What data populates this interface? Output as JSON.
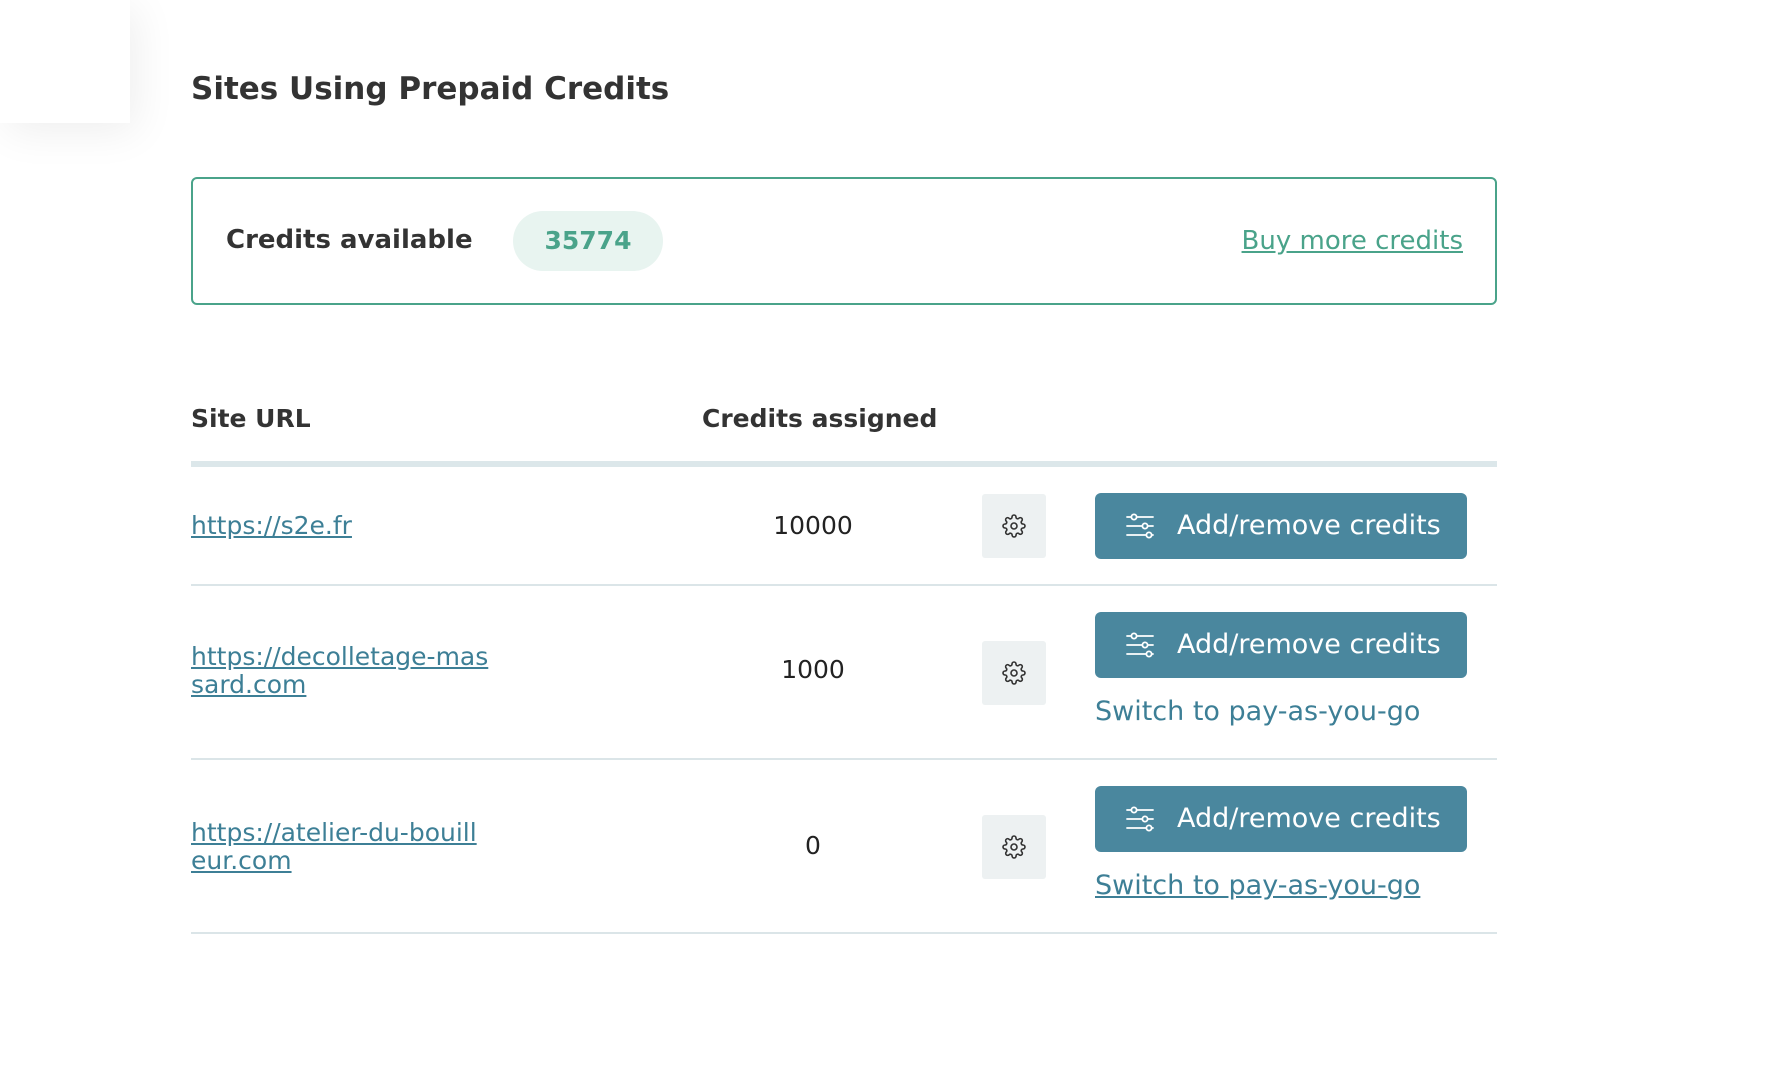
{
  "page": {
    "title": "Sites Using Prepaid Credits"
  },
  "credits": {
    "label": "Credits available",
    "available": "35774",
    "buy_link": "Buy more credits"
  },
  "table": {
    "headers": {
      "site_url": "Site URL",
      "credits_assigned": "Credits assigned"
    },
    "rows": [
      {
        "url": "https://s2e.fr",
        "credits": "10000",
        "action_button": "Add/remove credits",
        "switch_link": ""
      },
      {
        "url": "https://decolletage-massard.com",
        "credits": "1000",
        "action_button": "Add/remove credits",
        "switch_link": "Switch to pay-as-you-go"
      },
      {
        "url": "https://atelier-du-bouilleur.com",
        "credits": "0",
        "action_button": "Add/remove credits",
        "switch_link": "Switch to pay-as-you-go"
      }
    ]
  },
  "icons": {
    "settings": "gear-icon",
    "adjust": "sliders-icon"
  },
  "colors": {
    "accent_green": "#4aa38a",
    "badge_bg": "#e8f4f0",
    "button_blue": "#4a879e",
    "link_blue": "#3d7f96",
    "gear_bg": "#edf1f2"
  }
}
